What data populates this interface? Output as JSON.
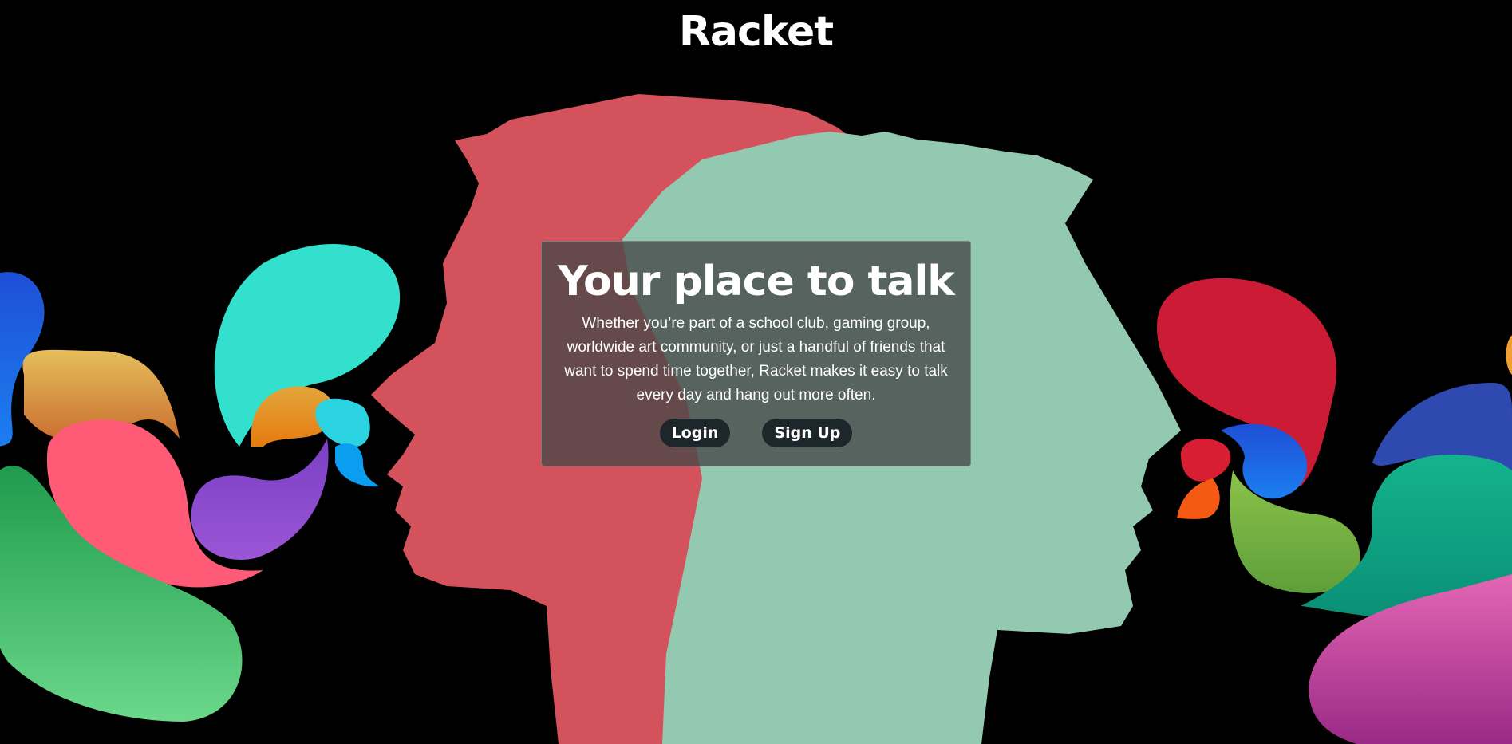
{
  "brand": {
    "name": "Racket"
  },
  "hero": {
    "title": "Your place to talk",
    "description": "Whether you’re part of a school club, gaming group, worldwide art community, or just a handful of friends that want to spend time together, Racket makes it easy to talk every day and hang out more often."
  },
  "actions": {
    "login_label": "Login",
    "signup_label": "Sign Up"
  },
  "colors": {
    "background": "#000000",
    "left_head": "#d4525b",
    "right_head": "#93c9b0",
    "card": "#464646",
    "button": "#1d262b"
  }
}
